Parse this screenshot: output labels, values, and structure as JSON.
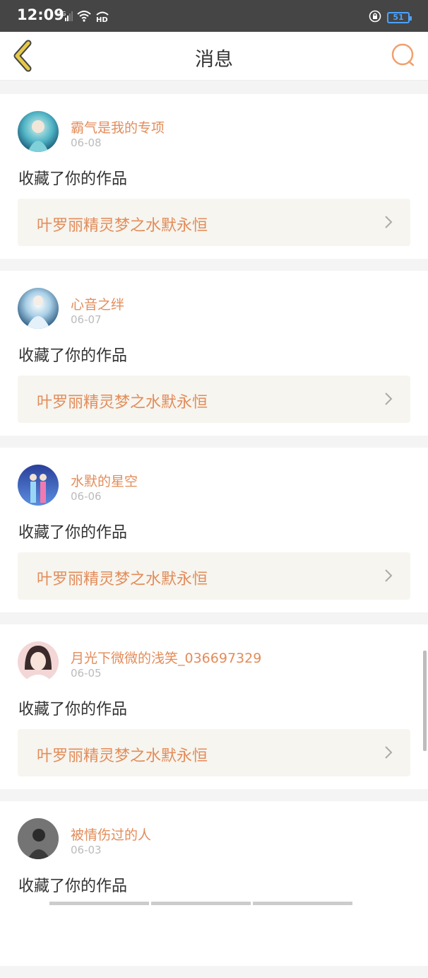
{
  "status_bar": {
    "time": "12:09",
    "network": "4G",
    "hd": "HD",
    "battery": "51",
    "icons": [
      "signal-icon",
      "wifi-icon",
      "hd-icon",
      "lock-rotation-icon",
      "battery-icon"
    ]
  },
  "header": {
    "title": "消息",
    "back_icon": "back-chevron-icon",
    "search_icon": "search-icon",
    "accent_color": "#e38c5a",
    "back_color": "#e6c94a"
  },
  "messages": [
    {
      "username": "霸气是我的专项",
      "date": "06-08",
      "action": "收藏了你的作品",
      "work_title": "叶罗丽精灵梦之水默永恒"
    },
    {
      "username": "心音之绊",
      "date": "06-07",
      "action": "收藏了你的作品",
      "work_title": "叶罗丽精灵梦之水默永恒"
    },
    {
      "username": "水默的星空",
      "date": "06-06",
      "action": "收藏了你的作品",
      "work_title": "叶罗丽精灵梦之水默永恒"
    },
    {
      "username": "月光下微微的浅笑_036697329",
      "date": "06-05",
      "action": "收藏了你的作品",
      "work_title": "叶罗丽精灵梦之水默永恒"
    },
    {
      "username": "被情伤过的人",
      "date": "06-03",
      "action": "收藏了你的作品",
      "work_title": ""
    }
  ]
}
